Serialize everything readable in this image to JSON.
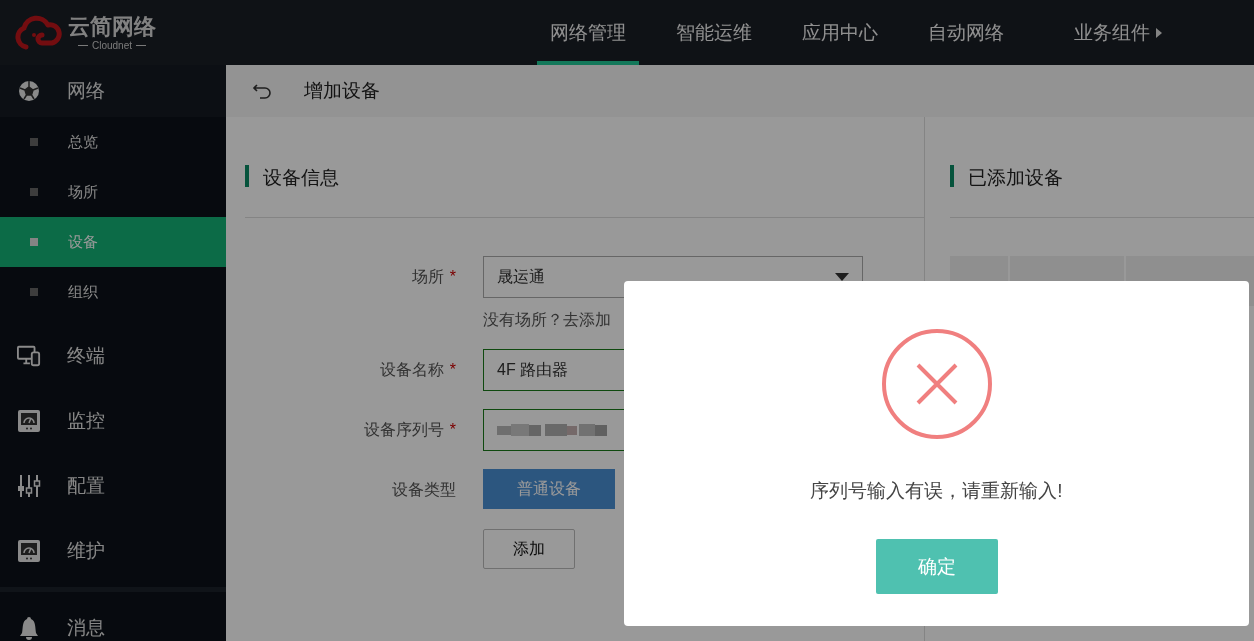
{
  "brand": {
    "name": "云简网络",
    "subtitle": "Cloudnet"
  },
  "top_nav": [
    {
      "label": "网络管理",
      "selected": true,
      "submenu": false
    },
    {
      "label": "智能运维",
      "selected": false,
      "submenu": false
    },
    {
      "label": "应用中心",
      "selected": false,
      "submenu": false
    },
    {
      "label": "自动网络",
      "selected": false,
      "submenu": false
    },
    {
      "label": "业务组件",
      "selected": false,
      "submenu": true
    }
  ],
  "sidebar": {
    "items": [
      {
        "label": "网络",
        "children": [
          {
            "label": "总览",
            "selected": false
          },
          {
            "label": "场所",
            "selected": false
          },
          {
            "label": "设备",
            "selected": true
          },
          {
            "label": "组织",
            "selected": false
          }
        ]
      },
      {
        "label": "终端"
      },
      {
        "label": "监控"
      },
      {
        "label": "配置"
      },
      {
        "label": "维护"
      }
    ],
    "footer": [
      {
        "label": "消息"
      }
    ]
  },
  "page_header": {
    "title": "增加设备"
  },
  "device_form": {
    "title": "设备信息",
    "fields": [
      {
        "kind": "select",
        "label": "场所",
        "marker": "*",
        "value": "晟运通",
        "hint": "没有场所？去添加"
      },
      {
        "kind": "text",
        "label": "设备名称",
        "marker": "*",
        "value": "4F 路由器"
      },
      {
        "kind": "masked",
        "label": "设备序列号",
        "marker": "*"
      },
      {
        "kind": "segmented",
        "label": "设备类型",
        "options": [
          {
            "label": "普通设备",
            "selected": true
          }
        ]
      }
    ],
    "add_button": "添加"
  },
  "added_devices": {
    "title": "已添加设备"
  },
  "dialog": {
    "kind": "error",
    "message": "序列号输入有误，请重新输入!",
    "confirm": "确定"
  }
}
